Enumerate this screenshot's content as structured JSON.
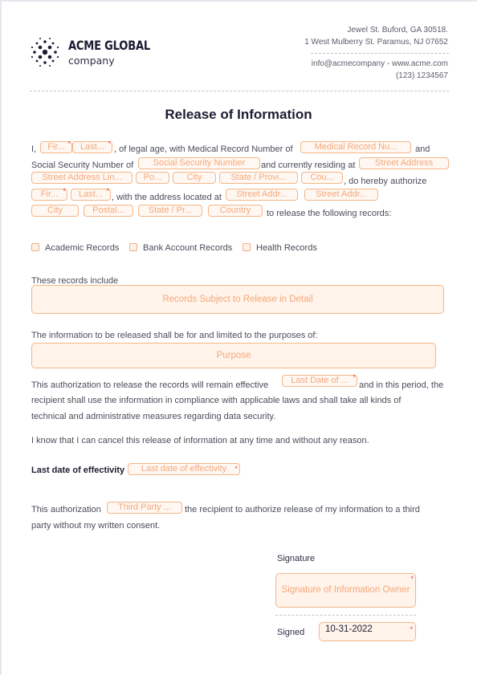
{
  "header": {
    "brand_name": "ACME GLOBAL",
    "brand_sub": "company",
    "address_line1": "Jewel St. Buford, GA 30518.",
    "address_line2": "1 West Mulberry St. Paramus, NJ 07652",
    "contact_line": "info@acmecompany - www.acme.com",
    "phone": "(123) 1234567"
  },
  "title": "Release of Information",
  "paragraph1": {
    "t_i": "I,",
    "f_first": "Fir...",
    "f_last": "Last...",
    "t_legal": ", of legal age, with Medical Record Number of",
    "f_mrn": "Medical Record Nu...",
    "t_and": "and",
    "t_ssn": "Social Security Number of",
    "f_ssn": "Social Security Number",
    "t_residing": "and currently residing at",
    "f_street": "Street Address",
    "f_street2": "Street Address Lin...",
    "f_postal": "Po...",
    "f_city": "City",
    "f_state": "State / Provi...",
    "f_country": "Cou...",
    "t_authorize": ", do hereby authorize",
    "f_first2": "Fir...",
    "f_last2": "Last...",
    "t_located": ", with the address located at",
    "f_addr1": "Street Addr...",
    "f_addr2": "Street Addr...",
    "f_city2": "City",
    "f_postal2": "Postal...",
    "f_state2": "State / Pr...",
    "f_country2": "Country",
    "t_release": "to release the following records:"
  },
  "checkboxes": [
    {
      "label": "Academic Records",
      "checked": false
    },
    {
      "label": "Bank Account Records",
      "checked": false
    },
    {
      "label": "Health Records",
      "checked": false
    }
  ],
  "records_label": "These records include",
  "records_placeholder": "Records Subject to Release in Detail",
  "purpose_label": "The information to be released shall be for and limited to the purposes of:",
  "purpose_placeholder": "Purpose",
  "paragraph2": {
    "t_start": "This authorization to release the records will remain effective",
    "f_date": "Last Date of ...",
    "t_end": "and in this period, the",
    "line2": "recipient shall use the information in compliance with applicable laws and shall take all kinds of",
    "line3": "technical and administrative measures regarding data security."
  },
  "cancel_text": "I know that I can cancel this release of information at any time and without any reason.",
  "last_date_label": "Last date of effectivity",
  "last_date_placeholder": "Last date of effectivity",
  "paragraph3": {
    "t_start": "This authorization",
    "f_party": "Third Party ...",
    "t_end": "the recipient to authorize release of my information to a third",
    "line2": "party without my written consent."
  },
  "signature": {
    "label": "Signature",
    "placeholder": "Signature of Information Owner",
    "signed_label": "Signed",
    "signed_value": "10-31-2022"
  },
  "required_mark": "*"
}
